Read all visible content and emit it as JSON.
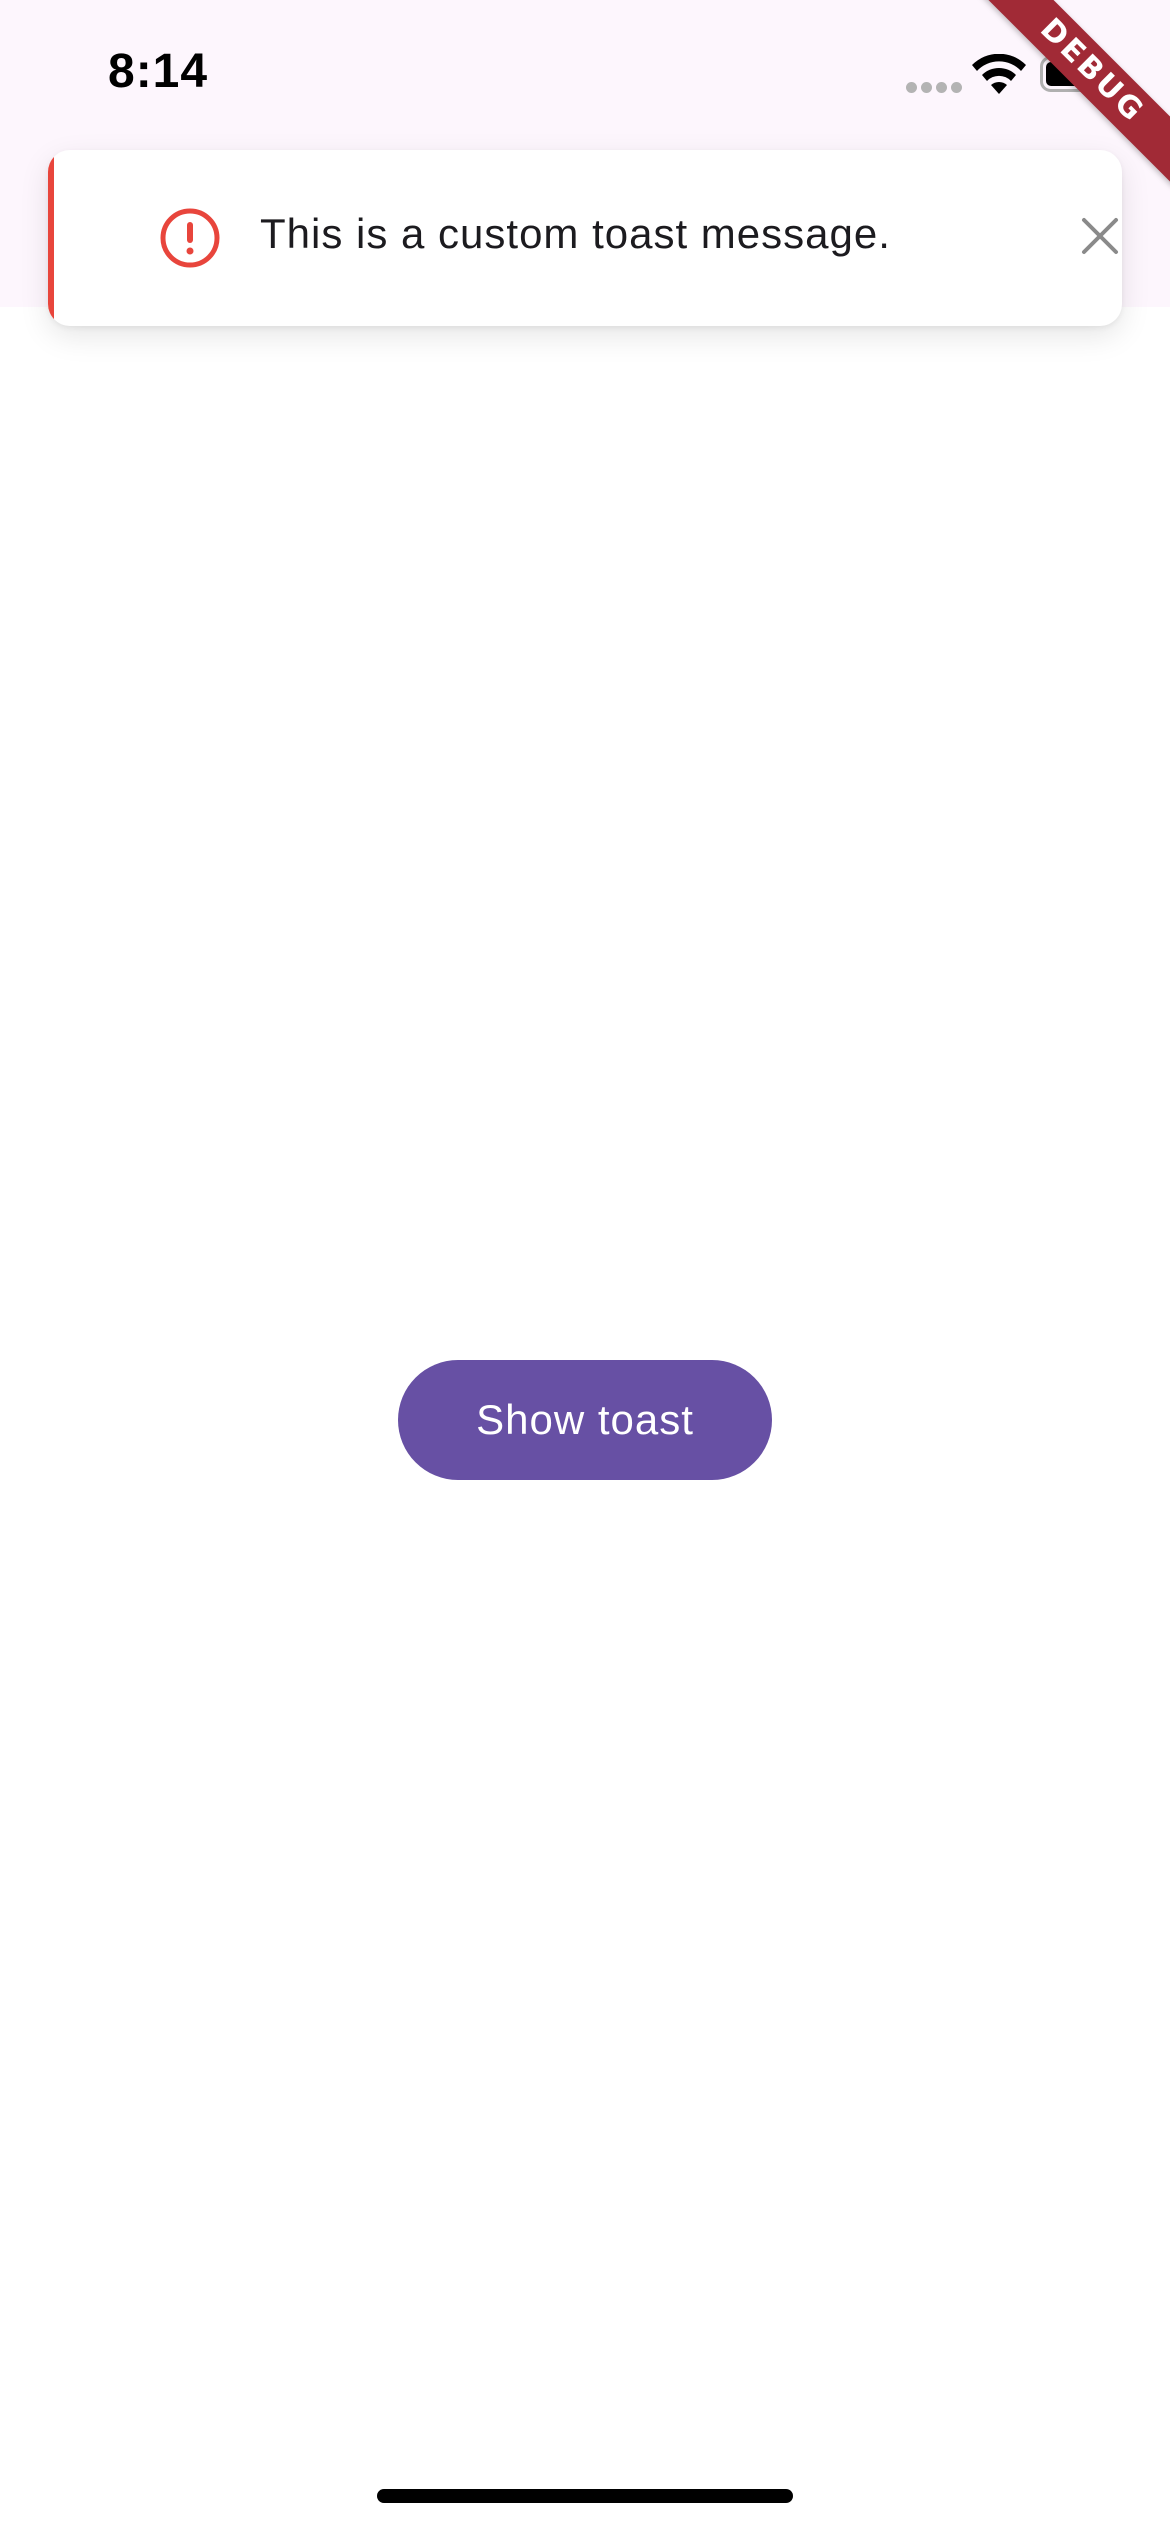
{
  "status_bar": {
    "time": "8:14",
    "icons": [
      "signal-icon",
      "wifi-icon",
      "battery-icon"
    ]
  },
  "debug_banner": {
    "label": "DEBUG",
    "color": "#a12a36"
  },
  "toast": {
    "message": "This is a custom toast message.",
    "type": "error",
    "icon": "error-circle-icon",
    "close_icon": "close-icon",
    "accent_color": "#e8453c"
  },
  "main": {
    "show_toast_label": "Show toast",
    "button_color": "#6750a4"
  },
  "colors": {
    "app_bar_background": "#fdf6fd",
    "page_background": "#ffffff"
  }
}
